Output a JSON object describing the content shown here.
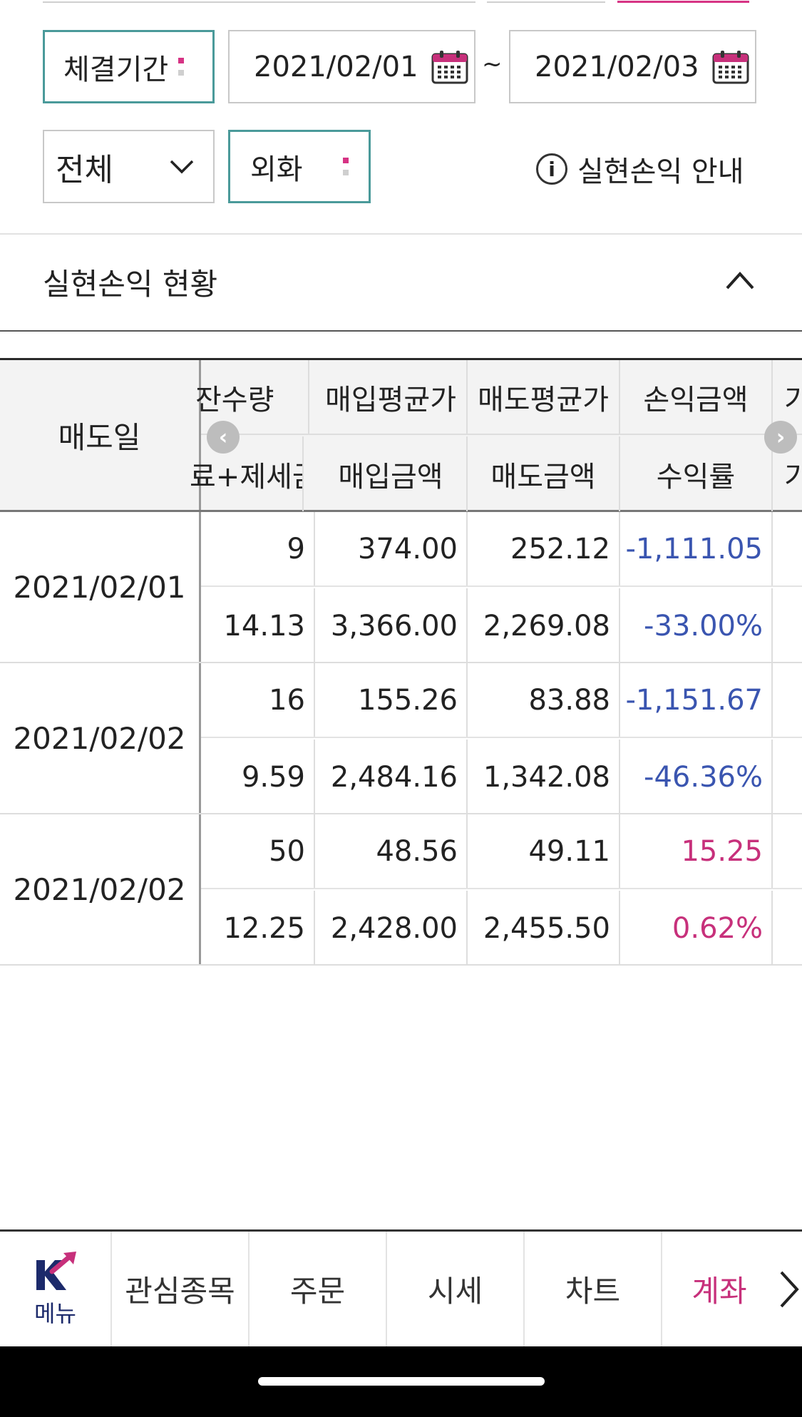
{
  "filters": {
    "period_label": "체결기간",
    "date_from": "2021/02/01",
    "date_to": "2021/02/03",
    "tilde": "~",
    "category_selected": "전체",
    "currency_label": "외화",
    "info_label": "실현손익 안내"
  },
  "section": {
    "title": "실현손익 현황"
  },
  "table": {
    "fixed_header": "매도일",
    "header_row1": [
      "잔수량",
      "매입평균가",
      "매도평균가",
      "손익금액",
      "기"
    ],
    "header_row2": [
      "료+제세금",
      "매입금액",
      "매도금액",
      "수익률",
      "기"
    ],
    "rows": [
      {
        "date": "2021/02/01",
        "r1": [
          "9",
          "374.00",
          "252.12",
          "-1,111.05"
        ],
        "r2": [
          "14.13",
          "3,366.00",
          "2,269.08",
          "-33.00%"
        ],
        "sign": "neg"
      },
      {
        "date": "2021/02/02",
        "r1": [
          "16",
          "155.26",
          "83.88",
          "-1,151.67"
        ],
        "r2": [
          "9.59",
          "2,484.16",
          "1,342.08",
          "-46.36%"
        ],
        "sign": "neg"
      },
      {
        "date": "2021/02/02",
        "r1": [
          "50",
          "48.56",
          "49.11",
          "15.25"
        ],
        "r2": [
          "12.25",
          "2,428.00",
          "2,455.50",
          "0.62%"
        ],
        "sign": "pos"
      }
    ]
  },
  "nav": {
    "menu_label": "메뉴",
    "items": [
      "관심종목",
      "주문",
      "시세",
      "차트",
      "계좌"
    ],
    "active": "계좌"
  },
  "colors": {
    "accent_pink": "#c7307b",
    "negative_blue": "#3a55b0",
    "teal_border": "#4a9a9a"
  }
}
